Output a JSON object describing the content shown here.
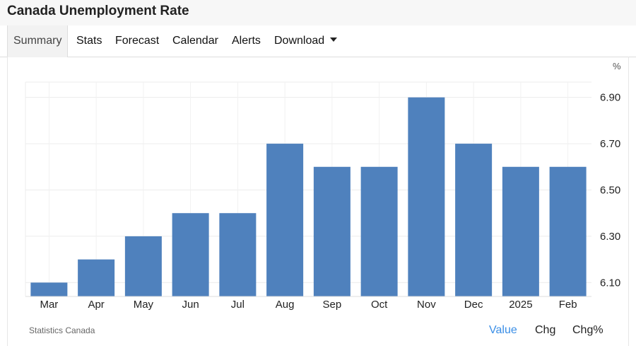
{
  "header": {
    "title": "Canada Unemployment Rate"
  },
  "tabs": [
    {
      "label": "Summary",
      "active": true
    },
    {
      "label": "Stats"
    },
    {
      "label": "Forecast"
    },
    {
      "label": "Calendar"
    },
    {
      "label": "Alerts"
    },
    {
      "label": "Download",
      "icon": "caret-down-icon"
    }
  ],
  "chart_data": {
    "type": "bar",
    "categories": [
      "Mar",
      "Apr",
      "May",
      "Jun",
      "Jul",
      "Aug",
      "Sep",
      "Oct",
      "Nov",
      "Dec",
      "2025",
      "Feb"
    ],
    "values": [
      6.1,
      6.2,
      6.3,
      6.4,
      6.4,
      6.7,
      6.6,
      6.6,
      6.9,
      6.7,
      6.6,
      6.6
    ],
    "ylabel": "%",
    "ylim": [
      6.04,
      6.96
    ],
    "yticks": [
      "6.10",
      "6.30",
      "6.50",
      "6.70",
      "6.90"
    ],
    "bar_color": "#4f81bd",
    "grid": true,
    "y_axis_position": "right"
  },
  "footer": {
    "source": "Statistics Canada",
    "views": [
      {
        "label": "Value",
        "active": true
      },
      {
        "label": "Chg"
      },
      {
        "label": "Chg%"
      }
    ]
  }
}
